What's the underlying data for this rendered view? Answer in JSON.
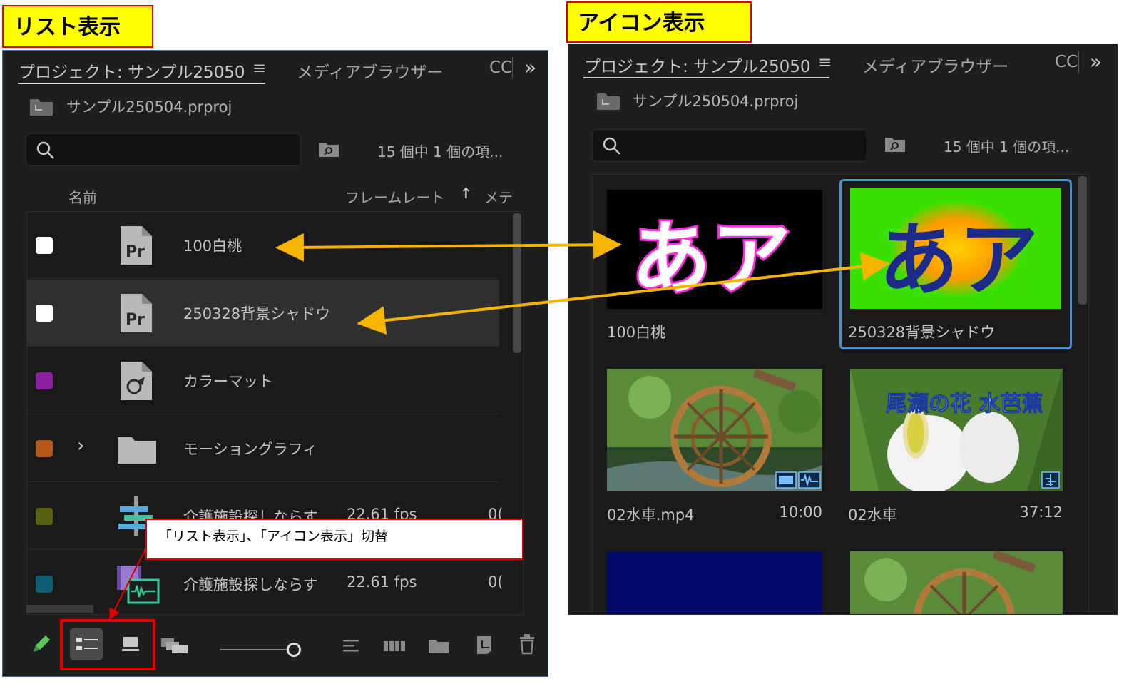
{
  "labels": {
    "list_view": "リスト表示",
    "icon_view": "アイコン表示"
  },
  "panel": {
    "tabs": {
      "project": "プロジェクト: サンプル25050",
      "media_browser": "メディアブラウザー",
      "cc": "CC",
      "overflow": "»",
      "menu": "≡"
    },
    "project_file": "サンプル250504.prproj",
    "search_placeholder": "",
    "item_count": "15 個中 1 個の項..."
  },
  "list_view": {
    "columns": {
      "name": "名前",
      "frame_rate": "フレームレート",
      "sort_arrow": "↑",
      "meta": "メテ"
    },
    "rows": [
      {
        "name": "100白桃",
        "label_color": "#ffffff",
        "icon": "premiere-sequence-icon",
        "fps": "",
        "extra": ""
      },
      {
        "name": "250328背景シャドウ",
        "label_color": "#ffffff",
        "icon": "premiere-sequence-icon",
        "fps": "",
        "extra": ""
      },
      {
        "name": "カラーマット",
        "label_color": "#8a1fa0",
        "icon": "color-matte-icon",
        "fps": "",
        "extra": ""
      },
      {
        "name": "モーショングラフィ",
        "label_color": "#b5561a",
        "icon": "folder-icon",
        "fps": "",
        "extra": ""
      },
      {
        "name": "介護施設探しならす",
        "label_color": "#5a5f12",
        "icon": "sequence-icon",
        "fps": "22.61 fps",
        "extra": "0("
      },
      {
        "name": "介護施設探しならす",
        "label_color": "#0f5d73",
        "icon": "video-audio-clip-icon",
        "fps": "22.61 fps",
        "extra": "0("
      }
    ]
  },
  "icon_view": {
    "items": [
      {
        "caption": "100白桃",
        "duration": "",
        "thumb_text": "あア"
      },
      {
        "caption": "250328背景シャドウ",
        "duration": "",
        "thumb_text": "あア"
      },
      {
        "caption": "02水車.mp4",
        "duration": "10:00",
        "thumb_text": ""
      },
      {
        "caption": "02水車",
        "duration": "37:12",
        "thumb_text": "尾瀬の花 水芭蕉"
      }
    ]
  },
  "annotation": {
    "tooltip": "「リスト表示」、「アイコン表示」切替"
  },
  "colors": {
    "panel_bg": "#1e1e1e",
    "label_yellow": "#ffff00",
    "annotation_red": "#e00000",
    "arrow_orange": "#f5b400",
    "selection_blue": "#4a90d9"
  }
}
